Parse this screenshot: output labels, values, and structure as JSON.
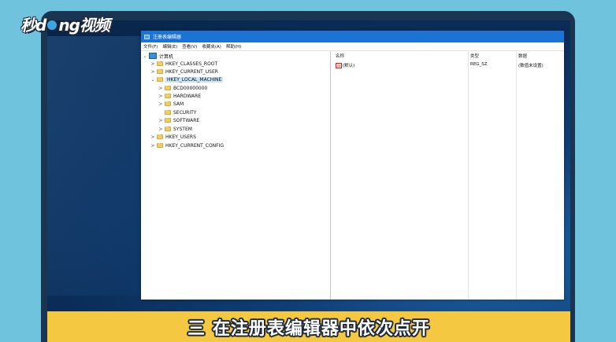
{
  "brand": {
    "logo_text_1": "秒d",
    "logo_text_2": "ng视频"
  },
  "window": {
    "title": "注册表编辑器",
    "menu": [
      "文件(F)",
      "编辑(E)",
      "查看(V)",
      "收藏夹(A)",
      "帮助(H)"
    ]
  },
  "tree": {
    "root": "计算机",
    "items": [
      {
        "label": "HKEY_CLASSES_ROOT",
        "chevron": ">"
      },
      {
        "label": "HKEY_CURRENT_USER",
        "chevron": ">"
      },
      {
        "label": "HKEY_LOCAL_MACHINE",
        "chevron": "v",
        "selected": true
      },
      {
        "label": "BCD00000000",
        "chevron": ">"
      },
      {
        "label": "HARDWARE",
        "chevron": ">"
      },
      {
        "label": "SAM",
        "chevron": ">"
      },
      {
        "label": "SECURITY",
        "chevron": ""
      },
      {
        "label": "SOFTWARE",
        "chevron": ">"
      },
      {
        "label": "SYSTEM",
        "chevron": ">"
      },
      {
        "label": "HKEY_USERS",
        "chevron": ">"
      },
      {
        "label": "HKEY_CURRENT_CONFIG",
        "chevron": ">"
      }
    ]
  },
  "values": {
    "columns": {
      "name": "名称",
      "type": "类型",
      "data": "数据"
    },
    "rows": [
      {
        "name": "(默认)",
        "type": "REG_SZ",
        "data": "(数值未设置)"
      }
    ]
  },
  "caption": "三  在注册表编辑器中依次点开",
  "colors": {
    "titlebar": "#1c73d6",
    "caption_bg": "#f5c842",
    "background": "#6fc3dc"
  }
}
